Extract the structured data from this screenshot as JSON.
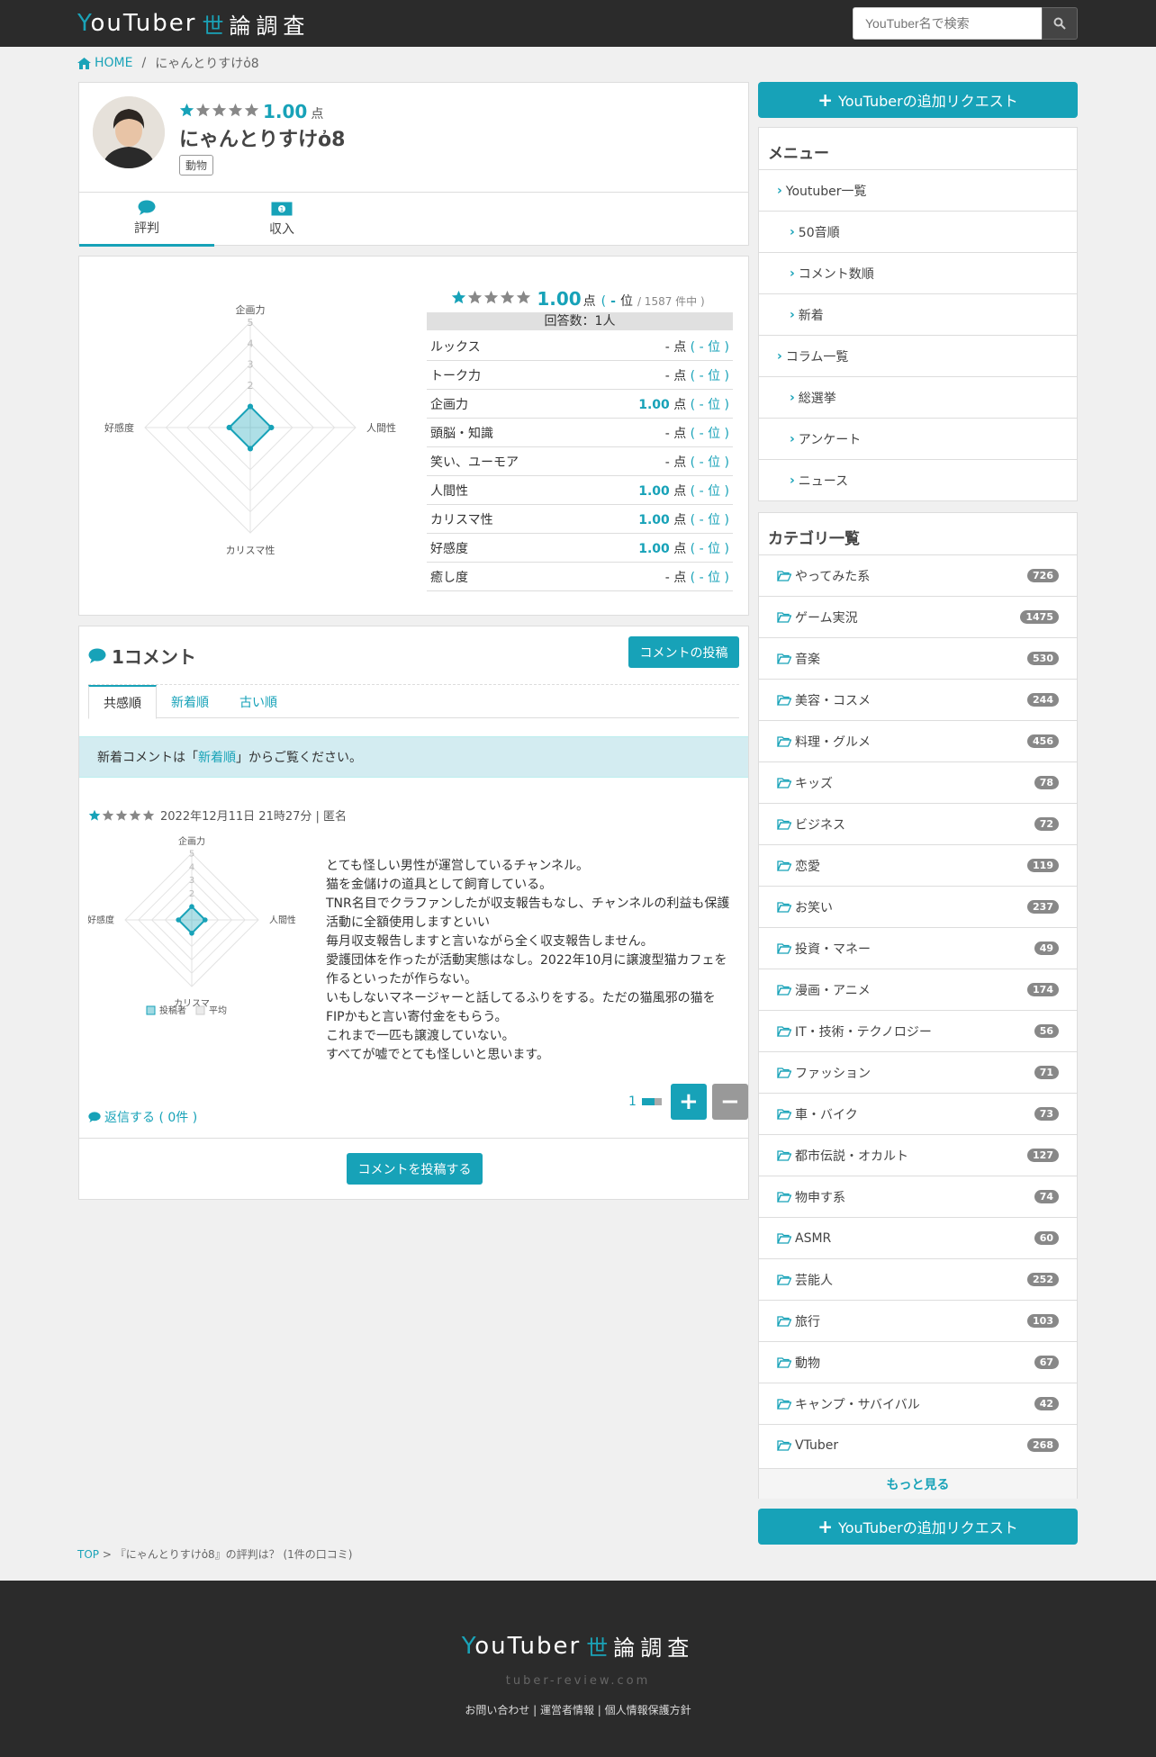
{
  "header": {
    "logo_latin": "YouTuber",
    "logo_kanji_1": "世",
    "logo_kanji_rest": "論調査",
    "search_placeholder": "YouTuber名で検索"
  },
  "breadcrumb": {
    "home": "HOME",
    "separator": "/",
    "current": "にゃんとりすけὀ8"
  },
  "profile": {
    "score": "1.00",
    "unit": "点",
    "name": "にゃんとりすけὀ8",
    "tag": "動物",
    "rating_stars": 1,
    "tabs": [
      {
        "label": "評判",
        "icon": "comment-icon"
      },
      {
        "label": "収入",
        "icon": "money-icon"
      }
    ]
  },
  "ratings": {
    "score": "1.00",
    "unit": "点",
    "rank_open": "(",
    "rank": "-",
    "rank_label": "位",
    "rank_total": "/ 1587 件中 )",
    "respondents": "回答数：1人",
    "rows": [
      {
        "label": "ルックス",
        "value": "-",
        "unit": "点",
        "rank": "( - 位 )"
      },
      {
        "label": "トーク力",
        "value": "-",
        "unit": "点",
        "rank": "( - 位 )"
      },
      {
        "label": "企画力",
        "value": "1.00",
        "unit": "点",
        "rank": "( - 位 )"
      },
      {
        "label": "頭脳・知識",
        "value": "-",
        "unit": "点",
        "rank": "( - 位 )"
      },
      {
        "label": "笑い、ユーモア",
        "value": "-",
        "unit": "点",
        "rank": "( - 位 )"
      },
      {
        "label": "人間性",
        "value": "1.00",
        "unit": "点",
        "rank": "( - 位 )"
      },
      {
        "label": "カリスマ性",
        "value": "1.00",
        "unit": "点",
        "rank": "( - 位 )"
      },
      {
        "label": "好感度",
        "value": "1.00",
        "unit": "点",
        "rank": "( - 位 )"
      },
      {
        "label": "癒し度",
        "value": "-",
        "unit": "点",
        "rank": "( - 位 )"
      }
    ]
  },
  "chart_data": [
    {
      "type": "radar",
      "axes": [
        "企画力",
        "人間性",
        "カリスマ性",
        "好感度"
      ],
      "ticks": [
        "2",
        "3",
        "4",
        "5"
      ],
      "rlim": [
        0,
        5
      ],
      "values": [
        1,
        1,
        1,
        1
      ],
      "color": "#17a2b8"
    },
    {
      "type": "radar",
      "axes": [
        "企画力",
        "人間性",
        "カリスマ",
        "好感度"
      ],
      "ticks": [
        "2",
        "3",
        "4",
        "5"
      ],
      "rlim": [
        0,
        5
      ],
      "series": [
        {
          "name": "投稿者",
          "values": [
            1,
            1,
            1,
            1
          ],
          "color": "#17a2b8"
        },
        {
          "name": "平均",
          "values": [
            1,
            1,
            1,
            1
          ],
          "color": "#cccccc"
        }
      ]
    }
  ],
  "comments": {
    "heading": "1コメント",
    "post_button": "コメントの投稿",
    "tabs": [
      "共感順",
      "新着順",
      "古い順"
    ],
    "notice_pre": "新着コメントは「",
    "notice_link": "新着順",
    "notice_post": "」からご覧ください。",
    "item": {
      "stars": 1,
      "meta": "2022年12月11日 21時27分 | 匿名",
      "lines": [
        "とても怪しい男性が運営しているチャンネル。",
        "猫を金儲けの道具として飼育している。",
        "TNR名目でクラファンしたが収支報告もなし、チャンネルの利益も保護活動に全額使用しますといい",
        "毎月収支報告しますと言いながら全く収支報告しません。",
        "愛護団体を作ったが活動実態はなし。2022年10月に譲渡型猫カフェを作るといったが作らない。",
        "いもしないマネージャーと話してるふりをする。ただの猫風邪の猫をFIPかもと言い寄付金をもらう。",
        "これまで一匹も譲渡していない。",
        "すべてが嘘でとても怪しいと思います。"
      ],
      "vote_count": "1",
      "plus": "+",
      "minus": "−",
      "reply": "返信する ( 0件 )"
    },
    "post_bottom": "コメントを投稿する"
  },
  "sidebar": {
    "request_button": "YouTuberの追加リクエスト",
    "menu_title": "メニュー",
    "menu": [
      {
        "label": "Youtuber一覧",
        "indent": false
      },
      {
        "label": "50音順",
        "indent": true
      },
      {
        "label": "コメント数順",
        "indent": true
      },
      {
        "label": "新着",
        "indent": true
      },
      {
        "label": "コラム一覧",
        "indent": false
      },
      {
        "label": "総選挙",
        "indent": true
      },
      {
        "label": "アンケート",
        "indent": true
      },
      {
        "label": "ニュース",
        "indent": true
      }
    ],
    "categories_title": "カテゴリ一覧",
    "categories": [
      {
        "label": "やってみた系",
        "count": "726"
      },
      {
        "label": "ゲーム実況",
        "count": "1475"
      },
      {
        "label": "音楽",
        "count": "530"
      },
      {
        "label": "美容・コスメ",
        "count": "244"
      },
      {
        "label": "料理・グルメ",
        "count": "456"
      },
      {
        "label": "キッズ",
        "count": "78"
      },
      {
        "label": "ビジネス",
        "count": "72"
      },
      {
        "label": "恋愛",
        "count": "119"
      },
      {
        "label": "お笑い",
        "count": "237"
      },
      {
        "label": "投資・マネー",
        "count": "49"
      },
      {
        "label": "漫画・アニメ",
        "count": "174"
      },
      {
        "label": "IT・技術・テクノロジー",
        "count": "56"
      },
      {
        "label": "ファッション",
        "count": "71"
      },
      {
        "label": "車・バイク",
        "count": "73"
      },
      {
        "label": "都市伝説・オカルト",
        "count": "127"
      },
      {
        "label": "物申す系",
        "count": "74"
      },
      {
        "label": "ASMR",
        "count": "60"
      },
      {
        "label": "芸能人",
        "count": "252"
      },
      {
        "label": "旅行",
        "count": "103"
      },
      {
        "label": "動物",
        "count": "67"
      },
      {
        "label": "キャンプ・サバイバル",
        "count": "42"
      },
      {
        "label": "VTuber",
        "count": "268"
      }
    ],
    "more": "もっと見る"
  },
  "bottom_breadcrumb": {
    "top": "TOP",
    "rest": " > 『にゃんとりすけὀ8』の評判は？ (1件の口コミ)"
  },
  "footer": {
    "domain": "tuber-review.com",
    "links": "お問い合わせ | 運営者情報 | 個人情報保護方針"
  }
}
